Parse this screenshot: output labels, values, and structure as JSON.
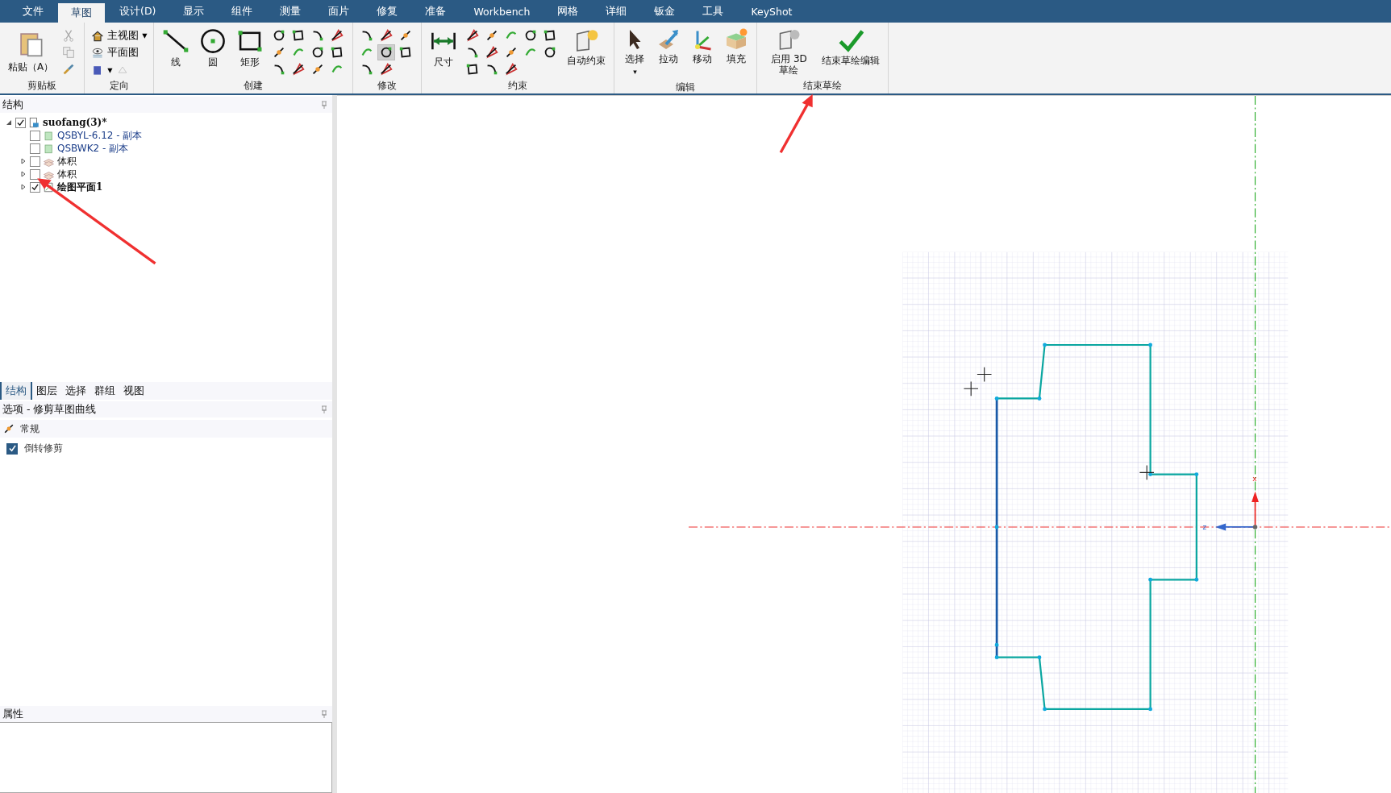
{
  "menu_tabs": [
    {
      "label": "文件",
      "selected": false
    },
    {
      "label": "草图",
      "selected": true
    },
    {
      "label": "设计(D)",
      "selected": false
    },
    {
      "label": "显示",
      "selected": false
    },
    {
      "label": "组件",
      "selected": false
    },
    {
      "label": "测量",
      "selected": false
    },
    {
      "label": "面片",
      "selected": false
    },
    {
      "label": "修复",
      "selected": false
    },
    {
      "label": "准备",
      "selected": false
    },
    {
      "label": "Workbench",
      "selected": false
    },
    {
      "label": "网格",
      "selected": false
    },
    {
      "label": "详细",
      "selected": false
    },
    {
      "label": "钣金",
      "selected": false
    },
    {
      "label": "工具",
      "selected": false
    },
    {
      "label": "KeyShot",
      "selected": false
    }
  ],
  "ribbon": {
    "clipboard": {
      "title": "剪贴板",
      "paste": "粘贴（A）"
    },
    "orient": {
      "title": "定向",
      "home": "主视图",
      "plan": "平面图",
      "caret": "▾"
    },
    "create": {
      "title": "创建",
      "tools": [
        {
          "label": "线",
          "kind": "line"
        },
        {
          "label": "圆",
          "kind": "circle"
        },
        {
          "label": "矩形",
          "kind": "rect"
        }
      ],
      "small_tools": [
        {
          "selected": false
        },
        {
          "selected": false
        },
        {
          "selected": false
        },
        {
          "selected": false
        },
        {
          "selected": false
        },
        {
          "selected": false
        },
        {
          "selected": false
        },
        {
          "selected": false
        },
        {
          "selected": false
        },
        {
          "selected": false
        },
        {
          "selected": false
        },
        {
          "selected": false
        }
      ]
    },
    "modify": {
      "title": "修改",
      "small_tools": [
        {
          "selected": false
        },
        {
          "selected": false
        },
        {
          "selected": false
        },
        {
          "selected": false
        },
        {
          "selected": true
        },
        {
          "selected": false
        },
        {
          "selected": false
        },
        {
          "selected": false
        }
      ]
    },
    "constrain": {
      "title": "约束",
      "dimension": "尺寸",
      "auto": "自动约束",
      "small_tools": [
        {
          "selected": false
        },
        {
          "selected": false
        },
        {
          "selected": false
        },
        {
          "selected": false
        },
        {
          "selected": false
        },
        {
          "selected": false
        },
        {
          "selected": false
        },
        {
          "selected": false
        },
        {
          "selected": false
        },
        {
          "selected": false
        },
        {
          "selected": false
        },
        {
          "selected": false
        },
        {
          "selected": false
        }
      ]
    },
    "edit": {
      "title": "编辑",
      "tools": [
        {
          "label": "选择",
          "kind": "select",
          "caret": "▾"
        },
        {
          "label": "拉动",
          "kind": "pull"
        },
        {
          "label": "移动",
          "kind": "move"
        },
        {
          "label": "填充",
          "kind": "fill"
        }
      ]
    },
    "finish": {
      "title": "结束草绘",
      "tools": [
        {
          "label": "启用 3D 草绘",
          "kind": "sketch3d"
        },
        {
          "label": "结束草绘编辑",
          "kind": "check"
        }
      ]
    }
  },
  "structure": {
    "title": "结构",
    "tree": [
      {
        "label": "suofang(3)*",
        "kind": "document",
        "checked": true,
        "bold": true,
        "expanded": true,
        "children": [
          {
            "label": "QSBYL-6.12 - 副本",
            "kind": "component",
            "checked": false,
            "bold": false
          },
          {
            "label": "QSBWK2 - 副本",
            "kind": "component",
            "checked": false,
            "bold": false
          },
          {
            "label": "体积",
            "kind": "body",
            "checked": false,
            "bold": false,
            "expanded": false
          },
          {
            "label": "体积",
            "kind": "body",
            "checked": false,
            "bold": false,
            "expanded": false
          },
          {
            "label": "绘图平面1",
            "kind": "plane",
            "checked": true,
            "bold": true,
            "expanded": false
          }
        ]
      }
    ]
  },
  "panel_tabs": [
    {
      "label": "结构",
      "selected": true
    },
    {
      "label": "图层",
      "selected": false
    },
    {
      "label": "选择",
      "selected": false
    },
    {
      "label": "群组",
      "selected": false
    },
    {
      "label": "视图",
      "selected": false
    }
  ],
  "options": {
    "title": "选项 - 修剪草图曲线",
    "section": "常规",
    "checkbox": {
      "label": "倒转修剪",
      "checked": true
    }
  },
  "properties": {
    "title": "属性"
  },
  "canvas": {
    "axis_labels": [
      "x",
      "z"
    ]
  }
}
